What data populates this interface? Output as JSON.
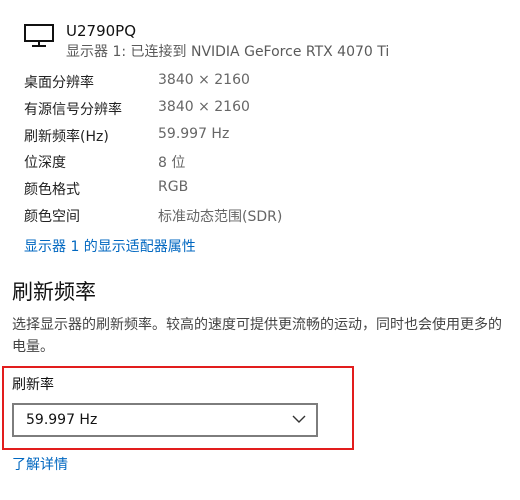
{
  "monitor": {
    "icon": "monitor-icon",
    "name": "U2790PQ",
    "connection": "显示器 1: 已连接到 NVIDIA GeForce RTX 4070 Ti"
  },
  "info": [
    {
      "label": "桌面分辨率",
      "value": "3840 × 2160"
    },
    {
      "label": "有源信号分辨率",
      "value": "3840 × 2160"
    },
    {
      "label": "刷新频率(Hz)",
      "value": "59.997 Hz"
    },
    {
      "label": "位深度",
      "value": "8 位"
    },
    {
      "label": "颜色格式",
      "value": "RGB"
    },
    {
      "label": "颜色空间",
      "value": "标准动态范围(SDR)"
    }
  ],
  "adapter_link": "显示器 1 的显示适配器属性",
  "refresh_section": {
    "title": "刷新频率",
    "description": "选择显示器的刷新频率。较高的速度可提供更流畅的运动，同时也会使用更多的电量。",
    "rate_label": "刷新率",
    "selected_rate": "59.997 Hz",
    "learn_more": "了解详情"
  },
  "colors": {
    "accent_link": "#0067c0",
    "highlight": "#e21d1d"
  }
}
